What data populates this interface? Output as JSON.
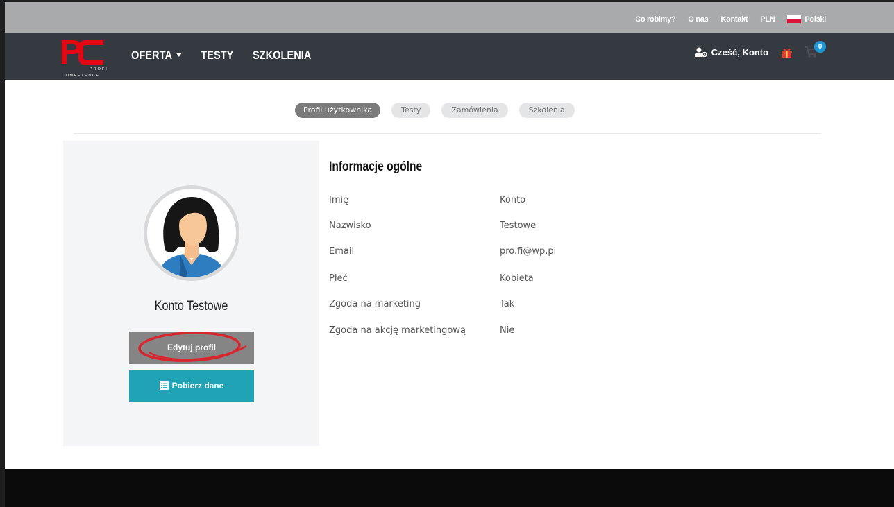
{
  "topbar": {
    "links": [
      "Co robimy?",
      "O nas",
      "Kontakt",
      "PLN"
    ],
    "language": "Polski"
  },
  "navbar": {
    "logo_text": "COMPETENCE",
    "logo_sub": "PROFI",
    "menu": [
      "OFERTA",
      "TESTY",
      "SZKOLENIA"
    ],
    "greeting": "Cześć, Konto",
    "cart_count": "0"
  },
  "tabs": [
    "Profil użytkownika",
    "Testy",
    "Zamówienia",
    "Szkolenia"
  ],
  "profile": {
    "name": "Konto Testowe",
    "edit_label": "Edytuj profil",
    "download_label": "Pobierz dane"
  },
  "info": {
    "title": "Informacje ogólne",
    "rows": [
      {
        "label": "Imię",
        "value": "Konto"
      },
      {
        "label": "Nazwisko",
        "value": "Testowe"
      },
      {
        "label": "Email",
        "value": "pro.fi@wp.pl"
      },
      {
        "label": "Płeć",
        "value": "Kobieta"
      },
      {
        "label": "Zgoda na marketing",
        "value": "Tak"
      },
      {
        "label": "Zgoda na akcję marketingową",
        "value": "Nie"
      }
    ]
  },
  "colors": {
    "nav_bg": "#343a40",
    "topbar_bg": "#a9aaab",
    "accent_teal": "#20a4b5",
    "logo_red": "#e30613",
    "highlight_ring": "#d8262e"
  }
}
